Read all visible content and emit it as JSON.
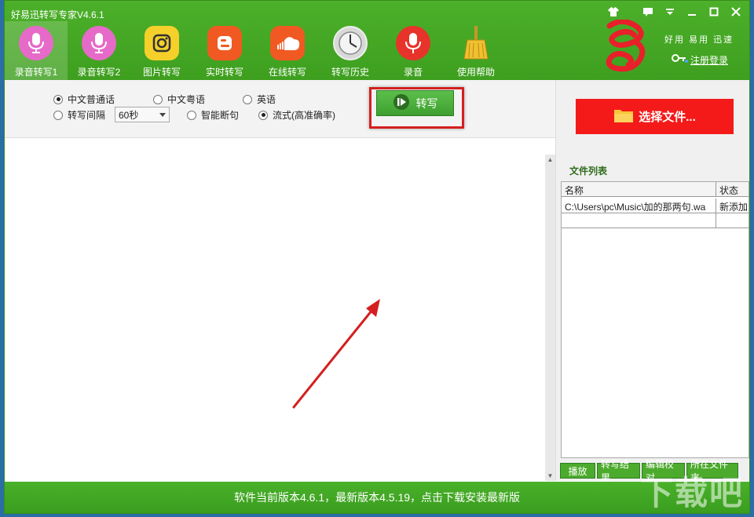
{
  "app": {
    "title": "好易迅转写专家V4.6.1"
  },
  "window_buttons": [
    "shirt-icon",
    "message-icon",
    "dropdown-icon",
    "minimize-icon",
    "maximize-icon",
    "close-icon"
  ],
  "toolbar": [
    {
      "label": "录音转写1",
      "icon": "mic-icon",
      "color": "#e66ac8",
      "active": true
    },
    {
      "label": "录音转写2",
      "icon": "mic-icon",
      "color": "#e66ac8"
    },
    {
      "label": "图片转写",
      "icon": "camera-icon",
      "color": "#f5d02a"
    },
    {
      "label": "实时转写",
      "icon": "blog-icon",
      "color": "#f05a22"
    },
    {
      "label": "在线转写",
      "icon": "cloud-icon",
      "color": "#f05a22"
    },
    {
      "label": "转写历史",
      "icon": "clock-icon",
      "color": "#d8d8d8"
    },
    {
      "label": "录音",
      "icon": "microphone-icon",
      "color": "#e8332a"
    },
    {
      "label": "使用帮助",
      "icon": "broom-icon",
      "color": "#e3b23c"
    }
  ],
  "brand": {
    "slogan": "好用 易用 迅速",
    "register_label": "注册登录"
  },
  "options": {
    "mandarin": "中文普通话",
    "cantonese": "中文粤语",
    "english": "英语",
    "interval_label": "转写间隔",
    "interval_value": "60秒",
    "smart_break": "智能断句",
    "streaming": "流式(高准确率)",
    "transcribe_label": "转写"
  },
  "right_panel": {
    "select_file_label": "选择文件...",
    "file_list_label": "文件列表",
    "columns": [
      "名称",
      "状态"
    ],
    "rows": [
      {
        "name": "C:\\Users\\pc\\Music\\加的那两句.wa",
        "status": "新添加"
      }
    ],
    "buttons": [
      "播放",
      "转写结果",
      "编辑校对",
      "所在文件夹"
    ]
  },
  "status_bar": {
    "text": "软件当前版本4.6.1，最新版本4.5.19，点击下载安装最新版"
  },
  "watermark": "下载吧",
  "colors": {
    "header_green": "#43a823",
    "select_red": "#f41a1a",
    "highlight_red": "#d42020"
  }
}
